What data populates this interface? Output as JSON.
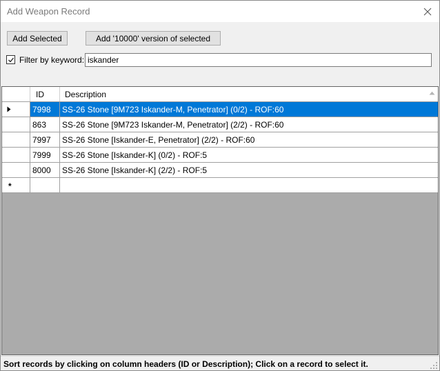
{
  "window": {
    "title": "Add Weapon Record",
    "close_icon": "close-icon"
  },
  "toolbar": {
    "add_selected_label": "Add Selected",
    "add_10000_label": "Add '10000' version of selected"
  },
  "filter": {
    "checked": true,
    "label": "Filter by keyword:",
    "value": "iskander"
  },
  "grid": {
    "columns": [
      "ID",
      "Description"
    ],
    "sort_column": "Description",
    "rows": [
      {
        "id": "7998",
        "description": "SS-26 Stone [9M723 Iskander-M, Penetrator] (0/2) - ROF:60",
        "selected": true
      },
      {
        "id": "863",
        "description": "SS-26 Stone [9M723 Iskander-M, Penetrator] (2/2) - ROF:60",
        "selected": false
      },
      {
        "id": "7997",
        "description": "SS-26 Stone [Iskander-E, Penetrator] (2/2) - ROF:60",
        "selected": false
      },
      {
        "id": "7999",
        "description": "SS-26 Stone [Iskander-K] (0/2) - ROF:5",
        "selected": false
      },
      {
        "id": "8000",
        "description": "SS-26 Stone [Iskander-K] (2/2) - ROF:5",
        "selected": false
      }
    ],
    "new_row_marker": "*",
    "selection_color": "#0078d7",
    "empty_area_color": "#ababab"
  },
  "status": {
    "text": "Sort records by clicking on column headers (ID or Description); Click on a record to select it."
  }
}
